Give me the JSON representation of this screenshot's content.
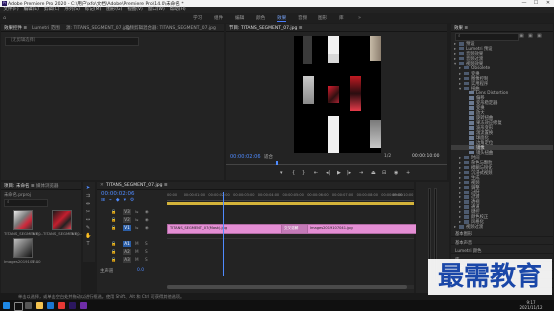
{
  "window": {
    "title": "Adobe Premiere Pro 2020 - C:\\用户\\xfo\\文档\\Adobe\\Premiere Pro\\14.0\\未命名 *",
    "minimize": "—",
    "maximize": "☐",
    "close": "✕"
  },
  "menu": [
    "文件(F)",
    "编辑(E)",
    "剪辑(C)",
    "序列(S)",
    "标记(M)",
    "图形(G)",
    "视图(V)",
    "窗口(W)",
    "帮助(H)"
  ],
  "workspaces": [
    "学习",
    "组件",
    "编辑",
    "颜色",
    "效果",
    "音频",
    "图形",
    "库"
  ],
  "active_workspace_index": 4,
  "source_panel": {
    "tabs": [
      "效果控件 ≡",
      "Lumetri 范围",
      "源: TITANS_SEGMENT_07.jpg",
      "音频剪辑混合器: TITANS_SEGMENT_07.jpg"
    ],
    "clip_field": "（无剪辑选择）"
  },
  "program_monitor": {
    "tab": "节目: TITANS_SEGMENT_07.jpg ≡",
    "timecode_left": "00:00:02:06",
    "fit": "适合",
    "ratio": "1/2",
    "timecode_right": "00:00:10:00"
  },
  "effects_panel": {
    "tab": "效果 ≡",
    "items": [
      {
        "label": "预设",
        "depth": 0,
        "open": false
      },
      {
        "label": "Lumetri 预设",
        "depth": 0,
        "open": false
      },
      {
        "label": "音频效果",
        "depth": 0,
        "open": false
      },
      {
        "label": "音频过渡",
        "depth": 0,
        "open": false
      },
      {
        "label": "视频效果",
        "depth": 0,
        "open": true
      },
      {
        "label": "Obsolete",
        "depth": 1,
        "open": false
      },
      {
        "label": "变换",
        "depth": 1,
        "open": false
      },
      {
        "label": "图像控制",
        "depth": 1,
        "open": false
      },
      {
        "label": "实用程序",
        "depth": 1,
        "open": false
      },
      {
        "label": "扭曲",
        "depth": 1,
        "open": true
      },
      {
        "label": "Lens Distortion",
        "depth": 2,
        "open": false
      },
      {
        "label": "偏移",
        "depth": 2,
        "open": false
      },
      {
        "label": "变形稳定器",
        "depth": 2,
        "open": false
      },
      {
        "label": "变换",
        "depth": 2,
        "open": false
      },
      {
        "label": "放大",
        "depth": 2,
        "open": false
      },
      {
        "label": "旋转扭曲",
        "depth": 2,
        "open": false
      },
      {
        "label": "果冻效应修复",
        "depth": 2,
        "open": false
      },
      {
        "label": "波形变形",
        "depth": 2,
        "open": false
      },
      {
        "label": "湍流置换",
        "depth": 2,
        "open": false
      },
      {
        "label": "球面化",
        "depth": 2,
        "open": false
      },
      {
        "label": "边角定位",
        "depth": 2,
        "open": false
      },
      {
        "label": "镜像",
        "depth": 2,
        "open": false,
        "selected": true
      },
      {
        "label": "镜头扭曲",
        "depth": 2,
        "open": false
      },
      {
        "label": "时间",
        "depth": 1,
        "open": false
      },
      {
        "label": "杂色与颗粒",
        "depth": 1,
        "open": false
      },
      {
        "label": "模糊与锐化",
        "depth": 1,
        "open": false
      },
      {
        "label": "沉浸式视频",
        "depth": 1,
        "open": false
      },
      {
        "label": "生成",
        "depth": 1,
        "open": false
      },
      {
        "label": "视频",
        "depth": 1,
        "open": false
      },
      {
        "label": "调整",
        "depth": 1,
        "open": false
      },
      {
        "label": "过时",
        "depth": 1,
        "open": false
      },
      {
        "label": "过渡",
        "depth": 1,
        "open": false
      },
      {
        "label": "透视",
        "depth": 1,
        "open": false
      },
      {
        "label": "通道",
        "depth": 1,
        "open": false
      },
      {
        "label": "键控",
        "depth": 1,
        "open": false
      },
      {
        "label": "颜色校正",
        "depth": 1,
        "open": false
      },
      {
        "label": "风格化",
        "depth": 1,
        "open": false
      },
      {
        "label": "视频过渡",
        "depth": 0,
        "open": false
      }
    ],
    "bottom_panels": [
      "基本图形",
      "基本声音",
      "Lumetri 颜色",
      "库",
      "标记",
      "历史记录",
      "信息"
    ]
  },
  "project_panel": {
    "tabs": [
      "项目: 未命名 ≡",
      "媒体浏览器"
    ],
    "project_file": "未命名.prproj",
    "items": [
      {
        "name": "TITANS_SEGMENT_...",
        "meta": "5:00"
      },
      {
        "name": "TITANS_SEGMENT_...",
        "meta": "5:00"
      },
      {
        "name": "Images2019107...",
        "meta": "5:00"
      }
    ]
  },
  "timeline": {
    "tab": "TITANS_SEGMENT_07.jpg ≡",
    "timecode": "00:00:02:06",
    "ruler": [
      "00:00",
      "00:00:01:00",
      "00:00:02:00",
      "00:00:03:00",
      "00:00:04:00",
      "00:00:05:00",
      "00:00:06:00",
      "00:00:07:00",
      "00:00:08:00",
      "00:00:09:00",
      "00:00:10:00"
    ],
    "tracks": [
      {
        "id": "V3",
        "kind": "video"
      },
      {
        "id": "V2",
        "kind": "video"
      },
      {
        "id": "V1",
        "kind": "video"
      },
      {
        "id": "A1",
        "kind": "audio"
      },
      {
        "id": "A2",
        "kind": "audio"
      },
      {
        "id": "A3",
        "kind": "audio"
      }
    ],
    "master": {
      "label": "主声道",
      "value": "0.0"
    },
    "clips": [
      {
        "label": "TITANS_SEGMENT_07(Mask).jpg"
      },
      {
        "label": "交叉溶解"
      },
      {
        "label": "Images2019107041.jpg"
      }
    ],
    "playhead_fraction": 0.225
  },
  "status": "单击以选择，或单击空白处并拖动以进行框选。使用 Shift、Alt 和 Ctrl 可获得其他选项。",
  "taskbar": {
    "time": "9:17",
    "date": "2021/11/12"
  },
  "watermark": "最需教育",
  "colors": {
    "accent": "#4f8bff",
    "clip": "#e48ed4",
    "watermark": "#1a47a8"
  }
}
